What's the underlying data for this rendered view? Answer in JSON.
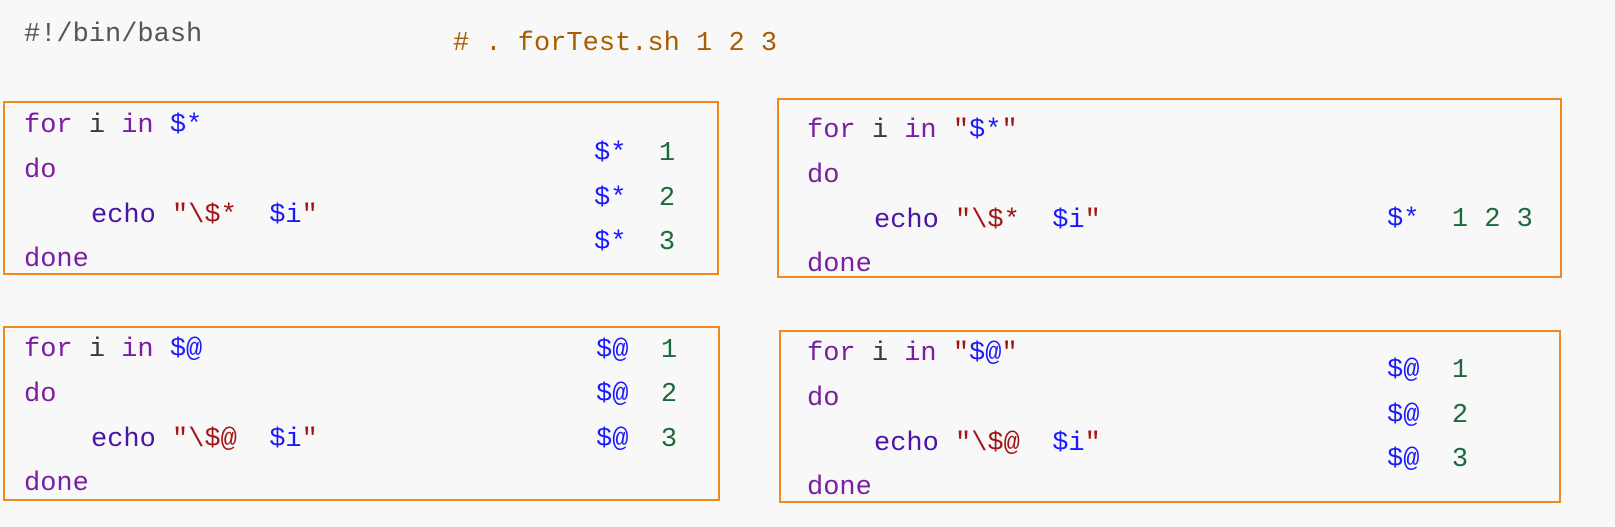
{
  "header": {
    "shebang": "#!/bin/bash",
    "run_comment": "# . forTest.sh 1 2 3"
  },
  "panels": {
    "star_unquoted": {
      "for": "for",
      "var": "i",
      "in": "in",
      "list": "$*",
      "do": "do",
      "echo": "echo",
      "q1": "\"",
      "esc": "\\$*",
      "ivar": "$i",
      "q2": "\"",
      "done": "done",
      "output": [
        {
          "sym": "$*",
          "val": "1"
        },
        {
          "sym": "$*",
          "val": "2"
        },
        {
          "sym": "$*",
          "val": "3"
        }
      ]
    },
    "star_quoted": {
      "for": "for",
      "var": "i",
      "in": "in",
      "qo": "\"",
      "list": "$*",
      "qc": "\"",
      "do": "do",
      "echo": "echo",
      "q1": "\"",
      "esc": "\\$*",
      "ivar": "$i",
      "q2": "\"",
      "done": "done",
      "output": [
        {
          "sym": "$*",
          "val": "1 2 3"
        }
      ]
    },
    "at_unquoted": {
      "for": "for",
      "var": "i",
      "in": "in",
      "list": "$@",
      "do": "do",
      "echo": "echo",
      "q1": "\"",
      "esc": "\\$@",
      "ivar": "$i",
      "q2": "\"",
      "done": "done",
      "output": [
        {
          "sym": "$@",
          "val": "1"
        },
        {
          "sym": "$@",
          "val": "2"
        },
        {
          "sym": "$@",
          "val": "3"
        }
      ]
    },
    "at_quoted": {
      "for": "for",
      "var": "i",
      "in": "in",
      "qo": "\"",
      "list": "$@",
      "qc": "\"",
      "do": "do",
      "echo": "echo",
      "q1": "\"",
      "esc": "\\$@",
      "ivar": "$i",
      "q2": "\"",
      "done": "done",
      "output": [
        {
          "sym": "$@",
          "val": "1"
        },
        {
          "sym": "$@",
          "val": "2"
        },
        {
          "sym": "$@",
          "val": "3"
        }
      ]
    }
  },
  "colors": {
    "keyword": "#7b1fa2",
    "special_var": "#1a1aff",
    "string": "#a31515",
    "number": "#1b6b3a",
    "border": "#f18a1c",
    "comment": "#a65e00"
  }
}
